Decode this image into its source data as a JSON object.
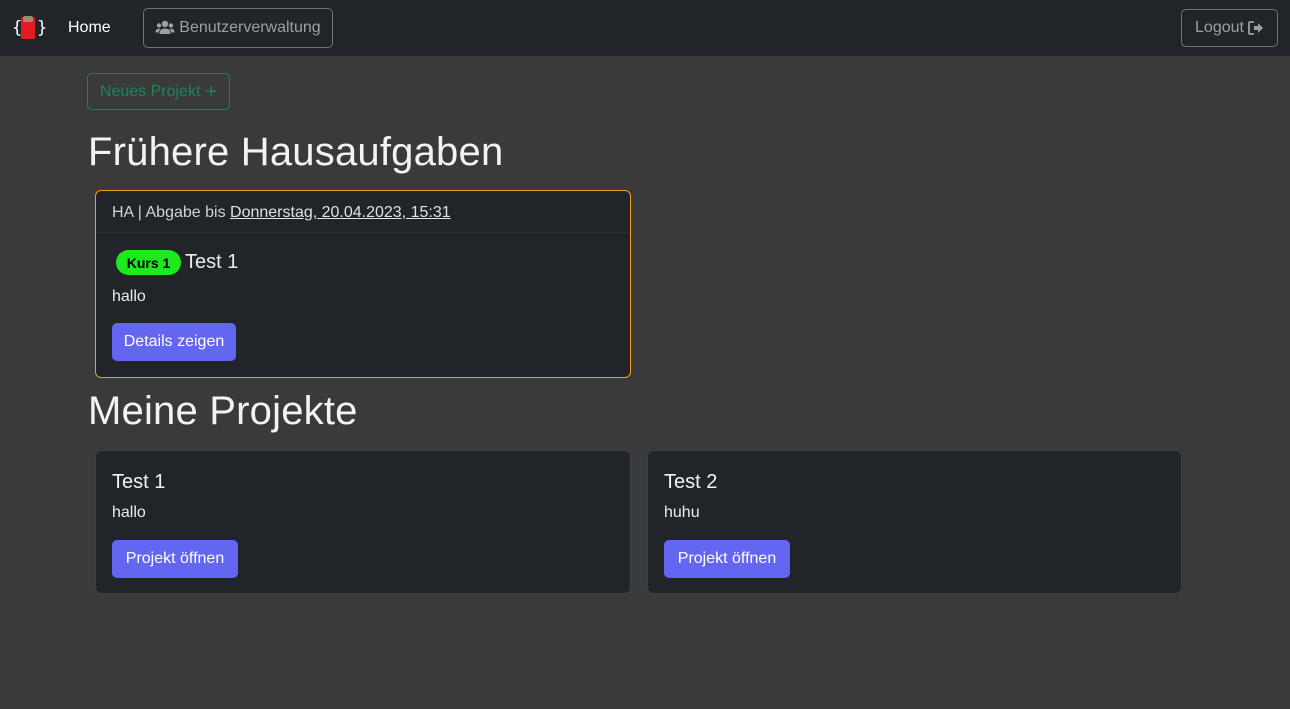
{
  "navbar": {
    "home_label": "Home",
    "users_label": "Benutzerverwaltung",
    "logout_label": "Logout"
  },
  "actions": {
    "new_project_label": "Neues Projekt"
  },
  "sections": {
    "homework_heading": "Frühere Hausaufgaben",
    "projects_heading": "Meine Projekte"
  },
  "homework": {
    "header_prefix": "HA | Abgabe bis ",
    "due": "Donnerstag, 20.04.2023, 15:31",
    "badge": "Kurs 1",
    "title": "Test 1",
    "text": "hallo",
    "button": "Details zeigen"
  },
  "projects": [
    {
      "title": "Test 1",
      "text": "hallo",
      "button": "Projekt öffnen"
    },
    {
      "title": "Test 2",
      "text": "huhu",
      "button": "Projekt öffnen"
    }
  ],
  "colors": {
    "background": "#3a3a3a",
    "navbar": "#212529",
    "card": "#212529",
    "primary": "#6366f1",
    "success": "#198754",
    "badge": "#1ee81e",
    "homework_border": "#f0a020"
  }
}
